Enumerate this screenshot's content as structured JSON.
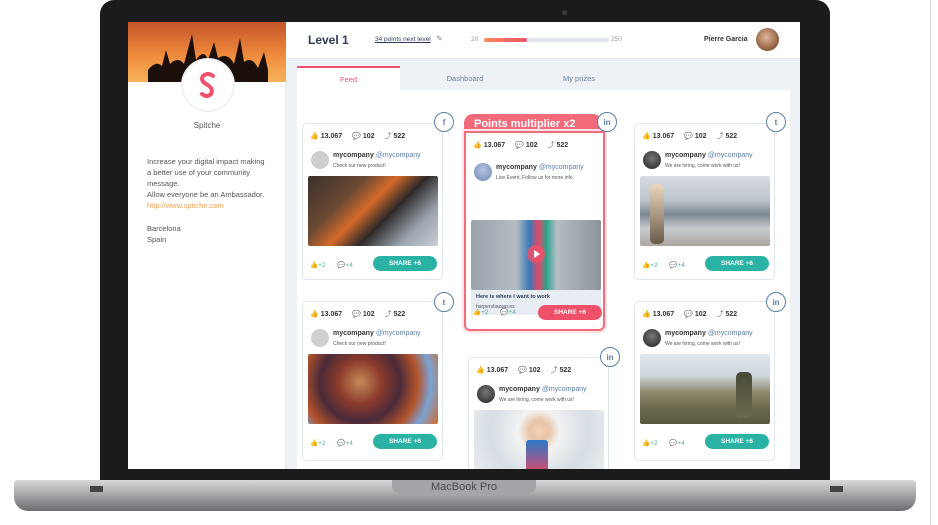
{
  "device": {
    "base_label": "MacBook Pro"
  },
  "sidebar": {
    "brand": "Spitche",
    "about_lines": [
      "Increase your digital impact making",
      "a better use of your community",
      "message.",
      "Allow everyone be an Ambassador."
    ],
    "link": "http://www.spitche.com",
    "city": "Barcelona",
    "country": "Spain"
  },
  "header": {
    "level": "Level 1",
    "next_level_text": "34 points next level",
    "points_min": "20",
    "points_max": "250",
    "progress": 0.34,
    "user_name": "Pierre Garcia"
  },
  "tabs": [
    {
      "label": "Feed",
      "active": true
    },
    {
      "label": "Dashboard",
      "active": false
    },
    {
      "label": "My prizes",
      "active": false
    }
  ],
  "multiplier_label": "Points multiplier x2",
  "cards": [
    {
      "network": "facebook",
      "likes": "13.067",
      "comments": "102",
      "shares": "522",
      "author": "mycompany",
      "handle": "@mycompany",
      "text": "Check our new product!",
      "foot_likes": "+2",
      "foot_comments": "+4",
      "share_label": "SHARE +6"
    },
    {
      "network": "twitter",
      "likes": "13.067",
      "comments": "102",
      "shares": "522",
      "author": "mycompany",
      "handle": "@mycompany",
      "text": "Check our new product!",
      "foot_likes": "+2",
      "foot_comments": "+4",
      "share_label": "SHARE +6"
    },
    {
      "network": "linkedin",
      "likes": "13.067",
      "comments": "102",
      "shares": "522",
      "author": "mycompany",
      "handle": "@mycompany",
      "text": "Live Event, Follow us for more info.",
      "link_title": "Here is where I want to work",
      "link_domain": "harpersbazaar.es",
      "foot_likes": "+2",
      "foot_comments": "+4",
      "share_label": "SHARE +6"
    },
    {
      "network": "linkedin",
      "likes": "13.067",
      "comments": "102",
      "shares": "522",
      "author": "mycompany",
      "handle": "@mycompany",
      "text": "We are hiring, come work with us!"
    },
    {
      "network": "twitter",
      "likes": "13.067",
      "comments": "102",
      "shares": "522",
      "author": "mycompany",
      "handle": "@mycompany",
      "text": "We are hiring, come work with us!",
      "foot_likes": "+2",
      "foot_comments": "+4",
      "share_label": "SHARE +6"
    },
    {
      "network": "linkedin",
      "likes": "13.067",
      "comments": "102",
      "shares": "522",
      "author": "mycompany",
      "handle": "@mycompany",
      "text": "We are hiring, come work with us!",
      "foot_likes": "+2",
      "foot_comments": "+4",
      "share_label": "SHARE +6"
    }
  ],
  "icons": {
    "like": "thumbs-up-icon",
    "comment": "comment-icon",
    "share": "share-icon",
    "twitter": "twitter-icon",
    "linkedin": "linkedin-icon",
    "facebook": "facebook-icon"
  },
  "colors": {
    "accent": "#f0506a",
    "share": "#2ab3a5",
    "link": "#f0a35a",
    "navy": "#2e3a59"
  }
}
